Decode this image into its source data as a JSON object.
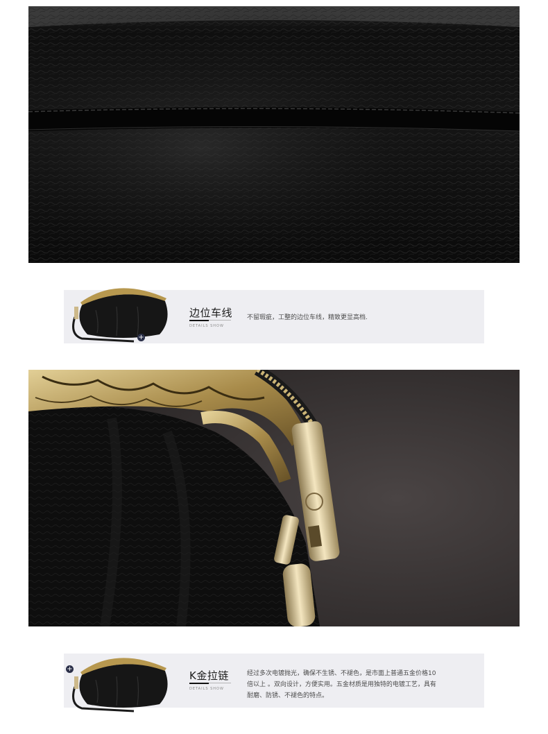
{
  "section1": {
    "title": "边位车线",
    "subtitle": "DETAILS SHOW",
    "description": "不留瑕疵，工整的边位车线，精致更显高档."
  },
  "section2": {
    "title": "K金拉链",
    "subtitle": "DETAILS SHOW",
    "description_lines": [
      "经过多次电镀抛光，确保不生锈、不褪色，是市面上普通五金价格10",
      "倍以上 。双向设计，方便实用。五金材质是用独特的电镀工艺，具有",
      "耐磨、防锈、不褪色的特点。"
    ]
  },
  "icons": {
    "plus": "+"
  },
  "colors": {
    "band": "#eeeef2",
    "leather": "#0d0d0d",
    "gold": "#b7984f"
  }
}
